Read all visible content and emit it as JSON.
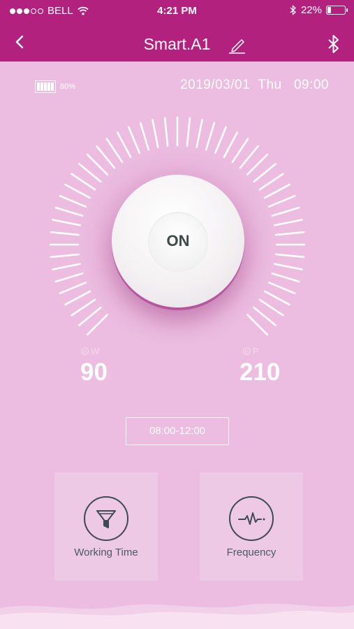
{
  "status_bar": {
    "carrier": "BELL",
    "time": "4:21 PM",
    "battery_text": "22%",
    "battery_level": 0.22
  },
  "nav": {
    "title": "Smart.A1",
    "back_icon": "chevron-left-icon",
    "edit_icon": "pencil-icon",
    "bluetooth_icon": "bluetooth-icon"
  },
  "device": {
    "battery_text": "80%",
    "battery_level": 0.8,
    "datetime": "2019/03/01  Thu   09:00"
  },
  "power": {
    "button_label": "ON"
  },
  "readouts": {
    "left": {
      "label": "W",
      "value": "90"
    },
    "right": {
      "label": "P",
      "value": "210"
    }
  },
  "schedule": {
    "time_range": "08:00-12:00"
  },
  "actions": [
    {
      "label": "Working Time",
      "icon": "funnel-icon"
    },
    {
      "label": "Frequency",
      "icon": "heartbeat-icon"
    }
  ],
  "colors": {
    "header": "#b3217f",
    "background": "#ecbde0",
    "card": "#eec9e6"
  }
}
